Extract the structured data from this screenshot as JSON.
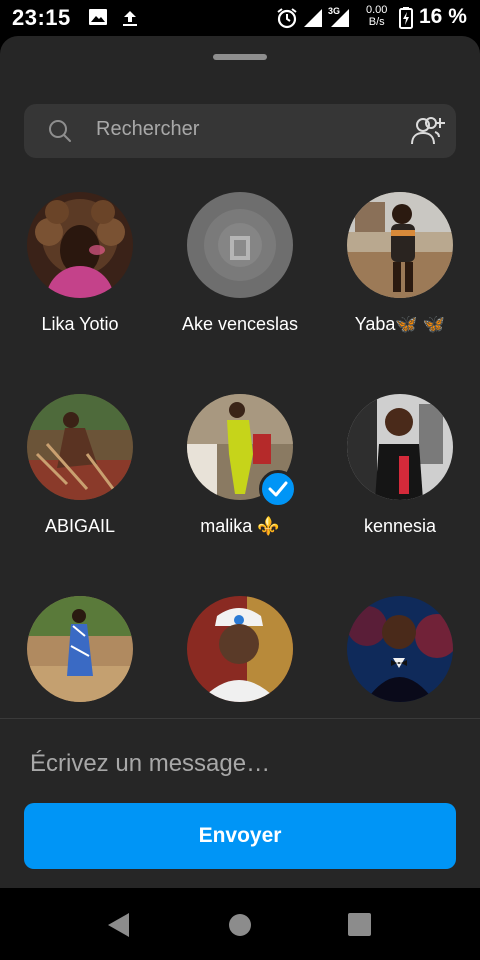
{
  "status_bar": {
    "time": "23:15",
    "network_type": "3G",
    "speed_value": "0.00",
    "speed_unit": "B/s",
    "battery_percent": "16 %",
    "icons": [
      "image-icon",
      "upload-icon",
      "alarm-icon",
      "signal-icon",
      "signal-3g-icon",
      "battery-charging-icon"
    ]
  },
  "search": {
    "placeholder": "Rechercher",
    "icons": [
      "search-icon",
      "add-people-icon"
    ]
  },
  "contacts": [
    {
      "name": "Lika Yotio",
      "selected": false
    },
    {
      "name": "Ake venceslas",
      "selected": false
    },
    {
      "name": "Yaba🦋 🦋",
      "selected": false
    },
    {
      "name": "ABIGAIL",
      "selected": false
    },
    {
      "name": "malika ⚜️",
      "selected": true
    },
    {
      "name": "kennesia",
      "selected": false
    },
    {
      "name": "",
      "selected": false
    },
    {
      "name": "",
      "selected": false
    },
    {
      "name": "",
      "selected": false
    }
  ],
  "compose": {
    "placeholder": "Écrivez un message…",
    "send_label": "Envoyer"
  },
  "colors": {
    "sheet_background": "#262626",
    "accent": "#0095f6",
    "secondary_text": "#a8a8a8"
  },
  "nav_bar": {
    "icons": [
      "back-icon",
      "home-icon",
      "recents-icon"
    ]
  }
}
